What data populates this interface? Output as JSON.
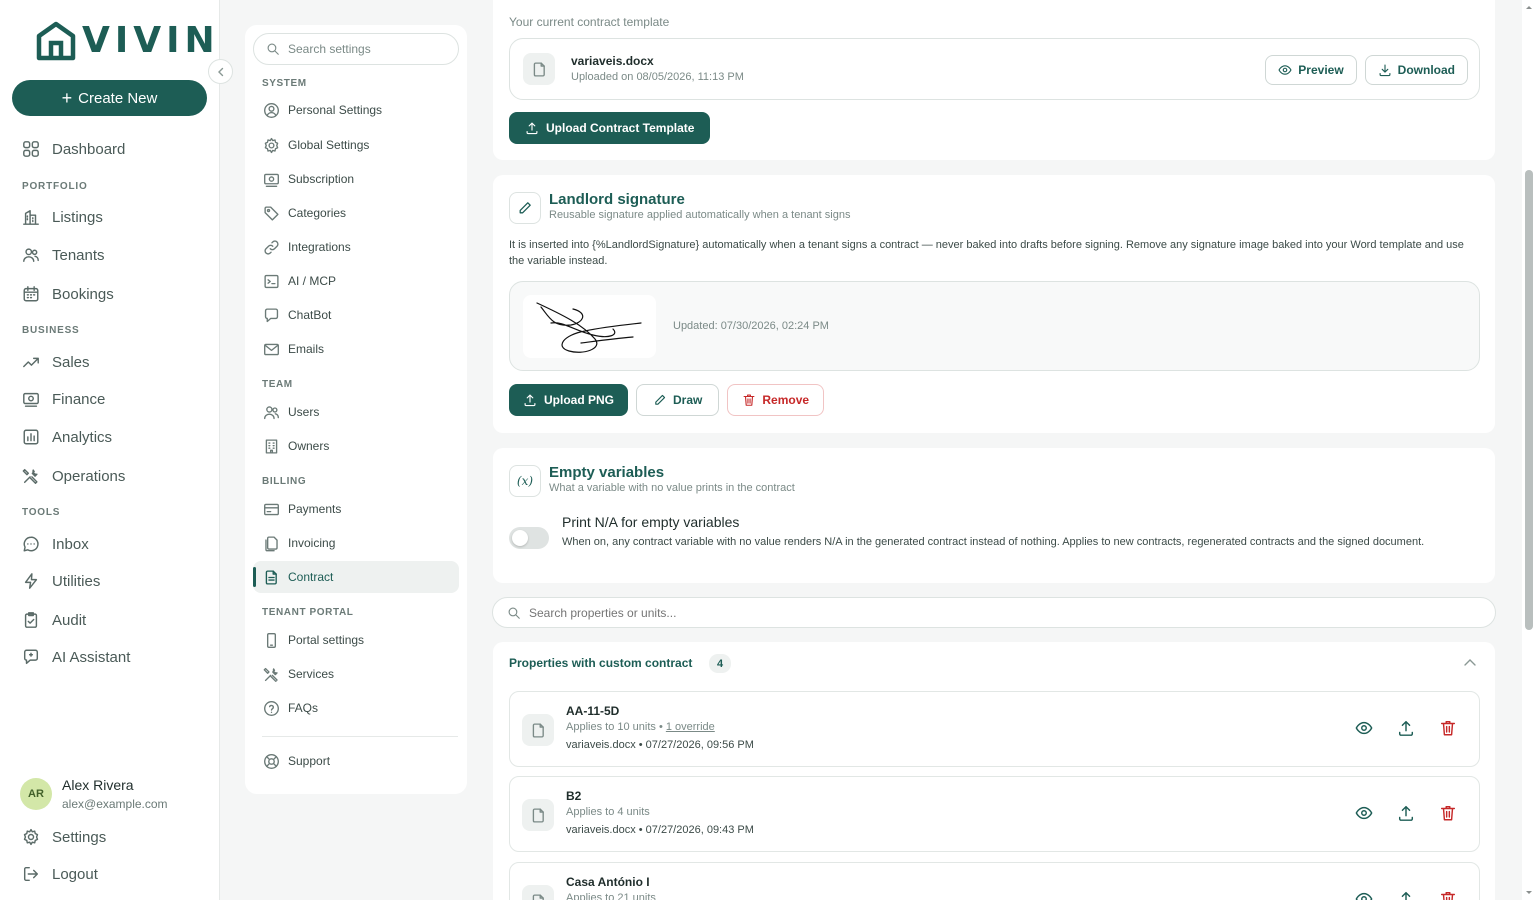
{
  "brand": {
    "name": "VIVIN",
    "color": "#1d5d55"
  },
  "sidebar": {
    "create_label": "Create New",
    "dashboard": "Dashboard",
    "sections": {
      "portfolio": "PORTFOLIO",
      "business": "BUSINESS",
      "tools": "TOOLS"
    },
    "portfolio_items": [
      "Listings",
      "Tenants",
      "Bookings"
    ],
    "business_items": [
      "Sales",
      "Finance",
      "Analytics",
      "Operations"
    ],
    "tools_items": [
      "Inbox",
      "Utilities",
      "Audit",
      "AI Assistant"
    ],
    "user": {
      "initials": "AR",
      "name": "Alex Rivera",
      "email": "alex@example.com"
    },
    "settings_label": "Settings",
    "logout_label": "Logout"
  },
  "settings_menu": {
    "search_placeholder": "Search settings",
    "system_label": "SYSTEM",
    "system_items": [
      "Personal Settings",
      "Global Settings",
      "Subscription",
      "Categories",
      "Integrations",
      "AI / MCP",
      "ChatBot",
      "Emails"
    ],
    "team_label": "TEAM",
    "team_items": [
      "Users",
      "Owners"
    ],
    "billing_label": "BILLING",
    "billing_items": [
      "Payments",
      "Invoicing",
      "Contract"
    ],
    "portal_label": "TENANT PORTAL",
    "portal_items": [
      "Portal settings",
      "Services",
      "FAQs"
    ],
    "support_label": "Support",
    "active": "Contract"
  },
  "template": {
    "label": "Your current contract template",
    "file_name": "variaveis.docx",
    "uploaded": "Uploaded on 08/05/2026, 11:13 PM",
    "preview_label": "Preview",
    "download_label": "Download",
    "upload_label": "Upload Contract Template"
  },
  "signature": {
    "title": "Landlord signature",
    "subtitle": "Reusable signature applied automatically when a tenant signs",
    "description": "It is inserted into {%LandlordSignature} automatically when a tenant signs a contract — never baked into drafts before signing. Remove any signature image baked into your Word template and use the variable instead.",
    "updated": "Updated: 07/30/2026, 02:24 PM",
    "upload_label": "Upload PNG",
    "draw_label": "Draw",
    "remove_label": "Remove"
  },
  "empty_vars": {
    "icon_text": "(x)",
    "title": "Empty variables",
    "subtitle": "What a variable with no value prints in the contract",
    "toggle_label": "Print N/A for empty variables",
    "toggle_on": false,
    "toggle_desc": "When on, any contract variable with no value renders N/A in the generated contract instead of nothing. Applies to new contracts, regenerated contracts and the signed document."
  },
  "property_search": {
    "placeholder": "Search properties or units..."
  },
  "custom_contracts": {
    "title": "Properties with custom contract",
    "count": "4",
    "rows": [
      {
        "name": "AA-11-5D",
        "applies": "Applies to 10 units • ",
        "override": "1 override",
        "file": "variaveis.docx • 07/27/2026, 09:56 PM"
      },
      {
        "name": "B2",
        "applies": "Applies to 4 units",
        "override": "",
        "file": "variaveis.docx • 07/27/2026, 09:43 PM"
      },
      {
        "name": "Casa António I",
        "applies": "Applies to 21 units",
        "override": "",
        "file": ""
      }
    ]
  }
}
